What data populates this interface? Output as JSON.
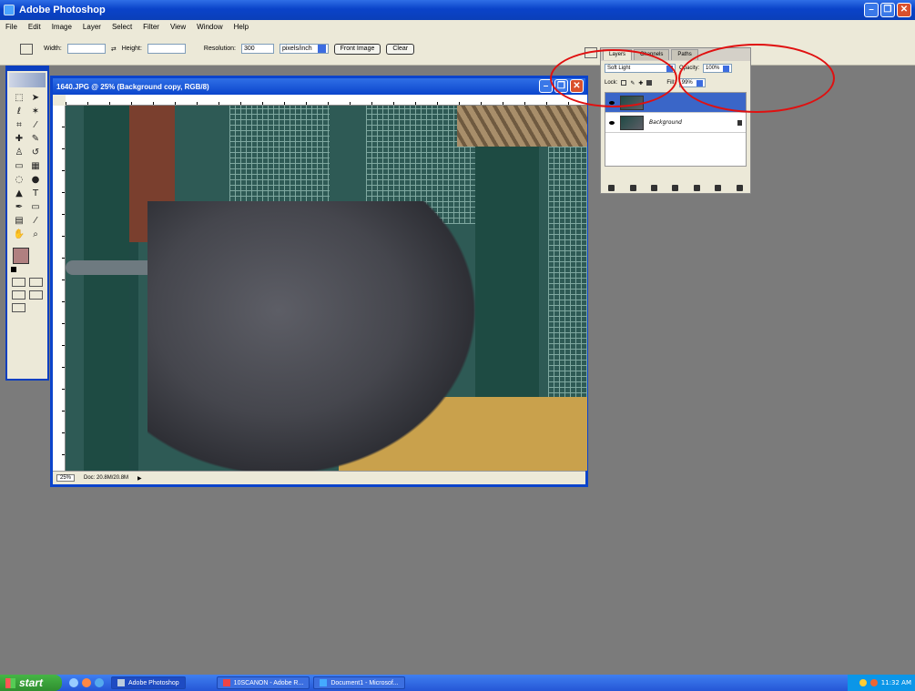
{
  "app": {
    "title": "Adobe Photoshop"
  },
  "menu": [
    "File",
    "Edit",
    "Image",
    "Layer",
    "Select",
    "Filter",
    "View",
    "Window",
    "Help"
  ],
  "options": {
    "width_label": "Width:",
    "height_label": "Height:",
    "resolution_label": "Resolution:",
    "resolution_value": "300",
    "units": "pixels/inch",
    "front_image": "Front Image",
    "clear": "Clear"
  },
  "document": {
    "title": "1640.JPG @ 25% (Background copy, RGB/8)",
    "zoom": "25%",
    "doc_size": "Doc: 20.8M/20.8M"
  },
  "layers_panel": {
    "tabs": [
      "Layers",
      "Channels",
      "Paths"
    ],
    "blend_mode": "Soft Light",
    "opacity_label": "Opacity:",
    "opacity_value": "100%",
    "lock_label": "Lock:",
    "fill_label": "Fill:",
    "fill_value": "99%",
    "layers": [
      {
        "name": "",
        "selected": true
      },
      {
        "name": "Background",
        "selected": false
      }
    ]
  },
  "taskbar": {
    "start": "start",
    "tasks": [
      "Adobe Photoshop",
      "10SCANON - Adobe R...",
      "Document1 - Microsof..."
    ],
    "clock": "11:32 AM"
  },
  "colors": {
    "foreground": "#b08080",
    "titlebar": "#0a43c9",
    "annotation": "#e01010"
  }
}
